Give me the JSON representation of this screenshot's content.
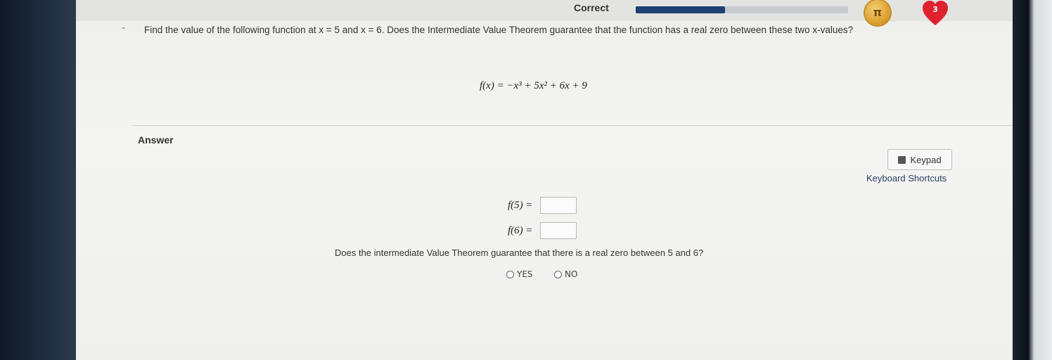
{
  "header": {
    "status": "Correct",
    "progress_fraction": 0.42,
    "coin_icon": "pi-coin-icon",
    "coin_symbol": "π",
    "heart_icon": "heart-icon",
    "hearts_count": "3",
    "heart_color": "#e0222e",
    "progress_color": "#1f3f73"
  },
  "question": {
    "text": "Find the value of the following function at x = 5 and x = 6. Does the Intermediate Value Theorem guarantee that the function has a real zero between these two x-values?",
    "formula": "f(x) = −x³ + 5x² + 6x + 9"
  },
  "answer": {
    "label": "Answer",
    "keypad_label": "Keypad",
    "keypad_icon": "calculator-icon",
    "shortcuts_label": "Keyboard Shortcuts",
    "f5_label": "f(5) =",
    "f5_value": "",
    "f6_label": "f(6) =",
    "f6_value": "",
    "ivt_question": "Does the intermediate Value Theorem guarantee that there is a real zero between 5 and 6?",
    "options": [
      "YES",
      "NO"
    ]
  }
}
